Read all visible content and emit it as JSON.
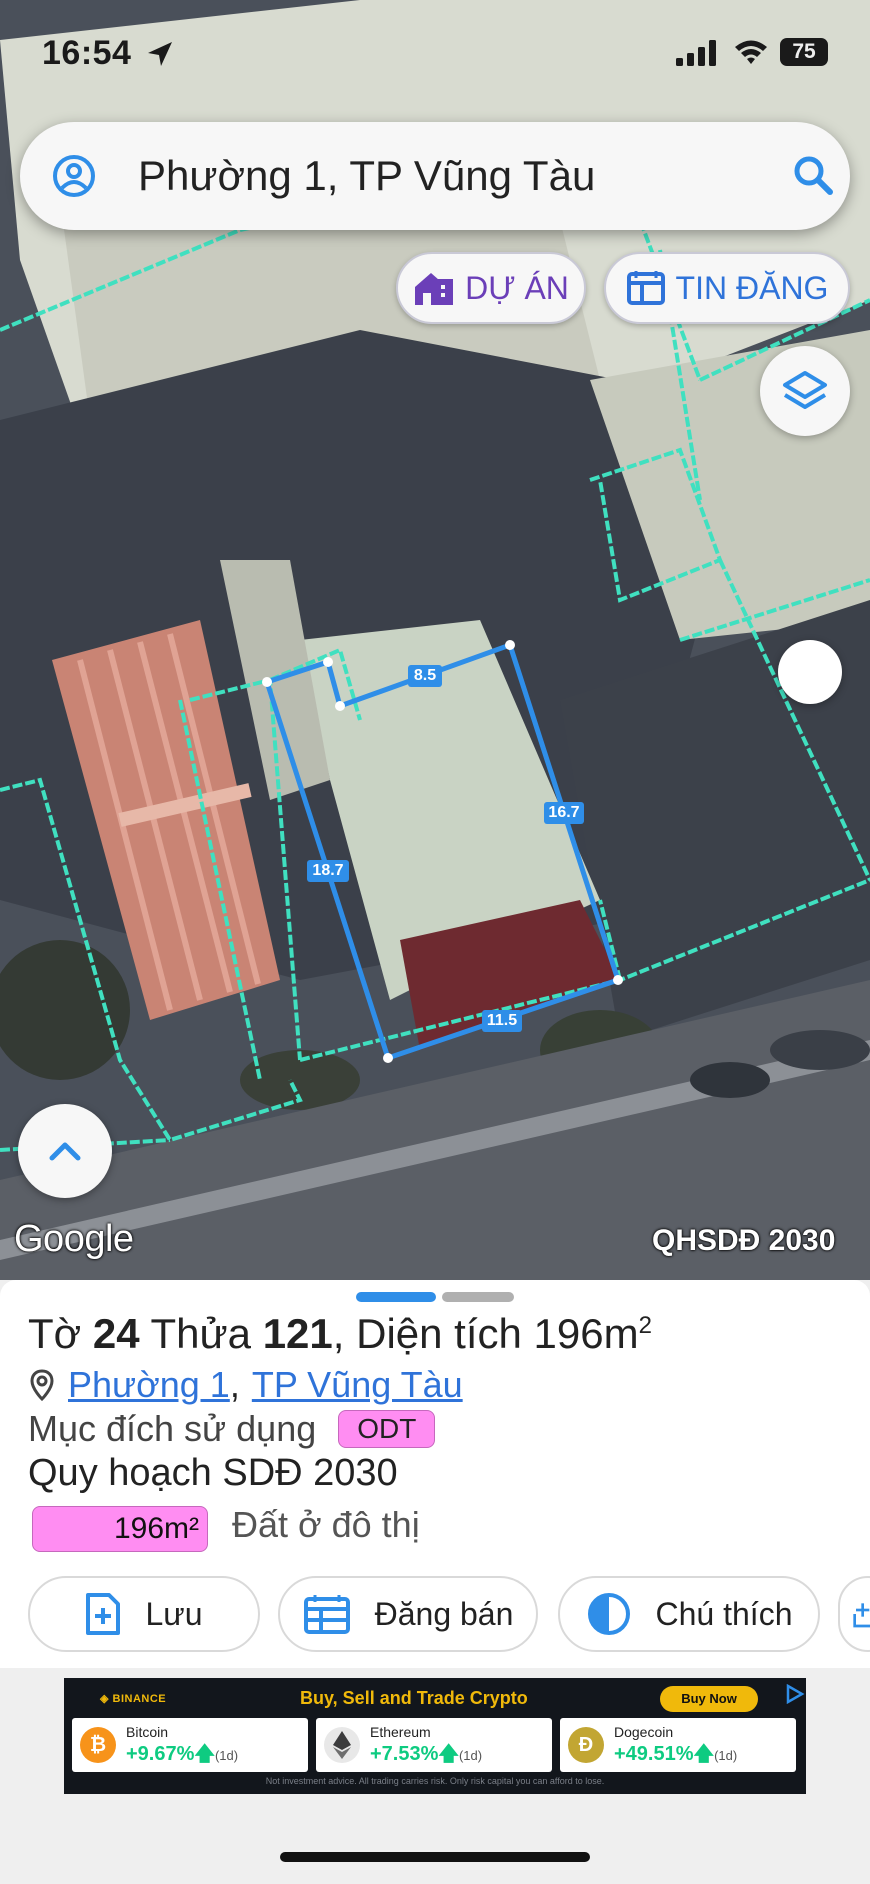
{
  "status_bar": {
    "time": "16:54",
    "battery": "75"
  },
  "search": {
    "value": "Phường 1, TP Vũng Tàu"
  },
  "map_buttons": {
    "du_an": "DỰ ÁN",
    "tin_dang": "TIN ĐĂNG"
  },
  "map": {
    "attribution": "Google",
    "layer_label": "QHSDĐ 2030",
    "edge_lengths": [
      "8.5",
      "16.7",
      "18.7",
      "11.5"
    ]
  },
  "parcel": {
    "title_prefix": "Tờ",
    "sheet_no": "24",
    "plot_label": "Thửa",
    "plot_no": "121",
    "area_label": "Diện tích",
    "area_value": "196m",
    "area_sup": "2",
    "ward_link": "Phường 1",
    "separator": ",",
    "city_link": "TP Vũng Tàu",
    "purpose_label": "Mục đích sử dụng",
    "purpose_code": "ODT",
    "plan_label": "Quy hoạch SDĐ 2030",
    "plan_area": "196m²",
    "plan_desc": "Đất ở đô thị"
  },
  "actions": {
    "save": "Lưu",
    "sell": "Đăng bán",
    "legend": "Chú thích"
  },
  "ad": {
    "brand": "BINANCE",
    "headline": "Buy, Sell and Trade Crypto",
    "cta": "Buy Now",
    "coins": [
      {
        "name": "Bitcoin",
        "change": "+9.67%",
        "period": "(1d)"
      },
      {
        "name": "Ethereum",
        "change": "+7.53%",
        "period": "(1d)"
      },
      {
        "name": "Dogecoin",
        "change": "+49.51%",
        "period": "(1d)"
      }
    ],
    "disclaimer": "Not investment advice. All trading carries risk. Only risk capital you can afford to lose."
  },
  "colors": {
    "accent_blue": "#2f8ee8",
    "purple": "#6b3fb8",
    "odt_pink": "#ff8df2",
    "parcel_outline": "#40e0c0",
    "binance_yellow": "#f0b90b"
  }
}
